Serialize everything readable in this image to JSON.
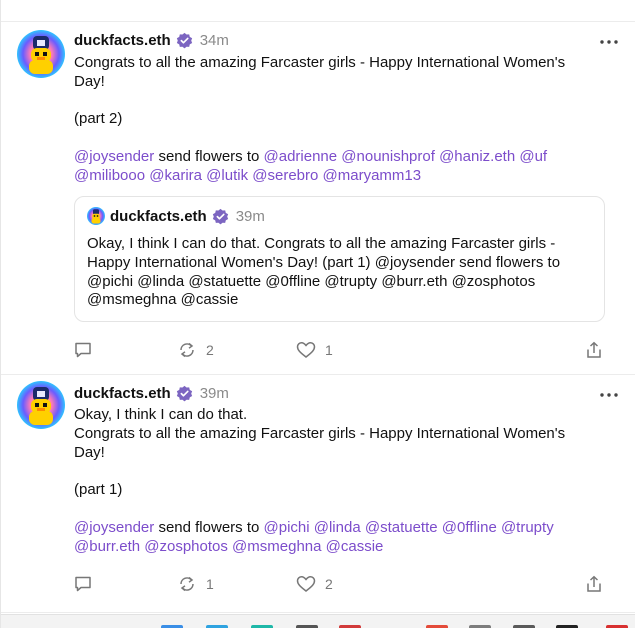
{
  "colors": {
    "mention": "#7c4dcb",
    "verified_badge": "#7c65c1",
    "muted_text": "#8a8a8a",
    "icon_gray": "#777777"
  },
  "top_partial_actions": {
    "recast_count": "2",
    "like_count": "1"
  },
  "casts": [
    {
      "username": "duckfacts.eth",
      "time": "34m",
      "lines": [
        [
          {
            "t": "Congrats to all the amazing Farcaster girls - Happy International Women's",
            "m": false
          }
        ],
        [
          {
            "t": "Day!",
            "m": false
          }
        ],
        [],
        [
          {
            "t": "(part 2)",
            "m": false
          }
        ],
        [],
        [
          {
            "t": "@joysender",
            "m": true
          },
          {
            "t": " send flowers to ",
            "m": false
          },
          {
            "t": "@adrienne",
            "m": true
          },
          {
            "t": " ",
            "m": false
          },
          {
            "t": "@nounishprof",
            "m": true
          },
          {
            "t": " ",
            "m": false
          },
          {
            "t": "@haniz.eth",
            "m": true
          },
          {
            "t": " ",
            "m": false
          },
          {
            "t": "@uf",
            "m": true
          }
        ],
        [
          {
            "t": "@milibooo",
            "m": true
          },
          {
            "t": " ",
            "m": false
          },
          {
            "t": "@karira",
            "m": true
          },
          {
            "t": " ",
            "m": false
          },
          {
            "t": "@lutik",
            "m": true
          },
          {
            "t": " ",
            "m": false
          },
          {
            "t": "@serebro",
            "m": true
          },
          {
            "t": " ",
            "m": false
          },
          {
            "t": "@maryamm13",
            "m": true
          }
        ]
      ],
      "quote": {
        "username": "duckfacts.eth",
        "time": "39m",
        "lines": [
          "Okay, I think I can do that. Congrats to all the amazing Farcaster girls -",
          "Happy International Women's Day! (part 1) @joysender send flowers to",
          "@pichi @linda @statuette @0ffline @trupty @burr.eth @zosphotos",
          "@msmeghna @cassie"
        ]
      },
      "recasts": "2",
      "likes": "1"
    },
    {
      "username": "duckfacts.eth",
      "time": "39m",
      "lines": [
        [
          {
            "t": "Okay, I think I can do that.",
            "m": false
          }
        ],
        [
          {
            "t": "Congrats to all the amazing Farcaster girls - Happy International Women's",
            "m": false
          }
        ],
        [
          {
            "t": "Day!",
            "m": false
          }
        ],
        [],
        [
          {
            "t": "(part 1)",
            "m": false
          }
        ],
        [],
        [
          {
            "t": "@joysender",
            "m": true
          },
          {
            "t": " send flowers to ",
            "m": false
          },
          {
            "t": "@pichi",
            "m": true
          },
          {
            "t": " ",
            "m": false
          },
          {
            "t": "@linda",
            "m": true
          },
          {
            "t": " ",
            "m": false
          },
          {
            "t": "@statuette",
            "m": true
          },
          {
            "t": " ",
            "m": false
          },
          {
            "t": "@0ffline",
            "m": true
          },
          {
            "t": " ",
            "m": false
          },
          {
            "t": "@trupty",
            "m": true
          }
        ],
        [
          {
            "t": "@burr.eth",
            "m": true
          },
          {
            "t": " ",
            "m": false
          },
          {
            "t": "@zosphotos",
            "m": true
          },
          {
            "t": " ",
            "m": false
          },
          {
            "t": "@msmeghna",
            "m": true
          },
          {
            "t": " ",
            "m": false
          },
          {
            "t": "@cassie",
            "m": true
          }
        ]
      ],
      "recasts": "1",
      "likes": "2"
    }
  ]
}
